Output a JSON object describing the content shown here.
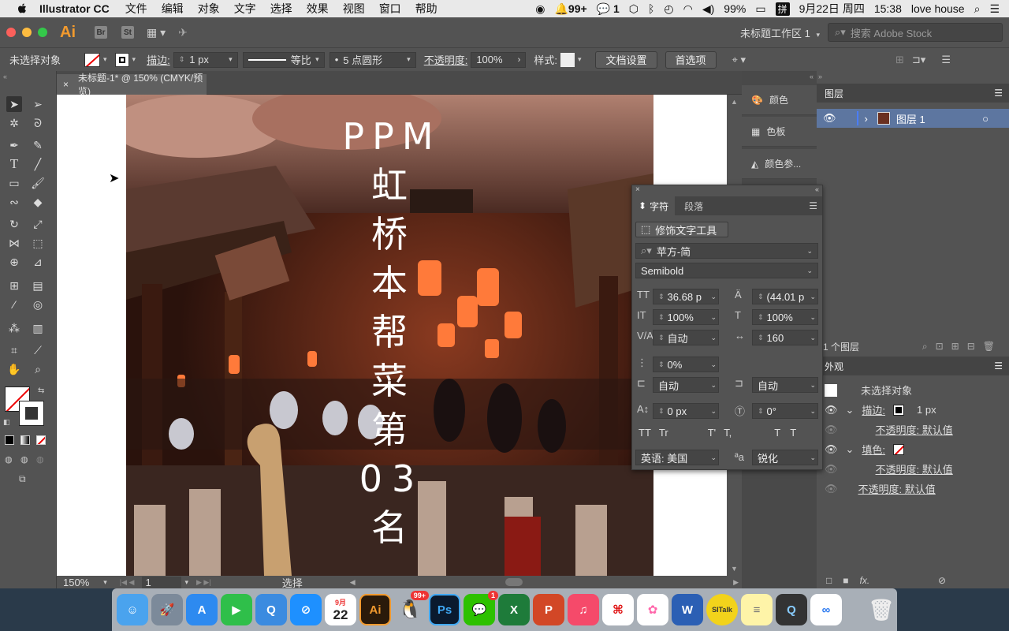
{
  "menubar": {
    "app_name": "Illustrator CC",
    "menus": [
      "文件",
      "编辑",
      "对象",
      "文字",
      "选择",
      "效果",
      "视图",
      "窗口",
      "帮助"
    ],
    "status": {
      "notif": "99+",
      "wechat": "1",
      "battery": "99%",
      "date": "9月22日 周四",
      "time": "15:38",
      "user": "love house",
      "ime": "拼"
    }
  },
  "appbar": {
    "logo": "Ai",
    "br": "Br",
    "st": "St",
    "workspace": "未标题工作区 1",
    "stock_placeholder": "搜索 Adobe Stock"
  },
  "control": {
    "no_selection": "未选择对象",
    "stroke_label": "描边:",
    "stroke_value": "1 px",
    "line_style": "等比",
    "brush": "5 点圆形",
    "opacity_label": "不透明度:",
    "opacity_value": "100%",
    "style_label": "样式:",
    "doc_setup": "文档设置",
    "preferences": "首选项"
  },
  "document": {
    "tab_title": "未标题-1* @ 150% (CMYK/预览)",
    "zoom": "150%",
    "page": "1",
    "mode": "选择",
    "text_lines": [
      "PPM",
      "虹",
      "桥",
      "本",
      "帮",
      "菜",
      "第",
      "03",
      "名"
    ]
  },
  "midpanel": {
    "items": [
      "颜色",
      "色板",
      "颜色参..."
    ]
  },
  "layers": {
    "title": "图层",
    "layer_name": "图层 1",
    "count": "1 个图层"
  },
  "appearance": {
    "title": "外观",
    "no_selection": "未选择对象",
    "stroke_label": "描边:",
    "stroke_value": "1 px",
    "opacity_default": "不透明度: 默认值",
    "fill_label": "填色:",
    "fill_opacity": "不透明度: 默认值",
    "opacity": "不透明度: 默认值"
  },
  "character": {
    "tab_char": "字符",
    "tab_para": "段落",
    "touchup": "修饰文字工具",
    "font": "苹方-简",
    "style": "Semibold",
    "size": "36.68 p",
    "leading": "(44.01 p",
    "vscale": "100%",
    "hscale": "100%",
    "kerning": "自动",
    "tracking": "160",
    "tsume": "0%",
    "aki_left": "自动",
    "aki_right": "自动",
    "baseline": "0 px",
    "rotation": "0°",
    "language": "英语: 美国",
    "aa": "锐化",
    "caps": [
      "TT",
      "Tr",
      "T'",
      "T,",
      "T",
      "T"
    ]
  },
  "dock": {
    "calendar_day": "22",
    "calendar_month": "9月",
    "qq_badge": "99+",
    "wechat_badge": "1",
    "sitalk": "SITalk"
  }
}
